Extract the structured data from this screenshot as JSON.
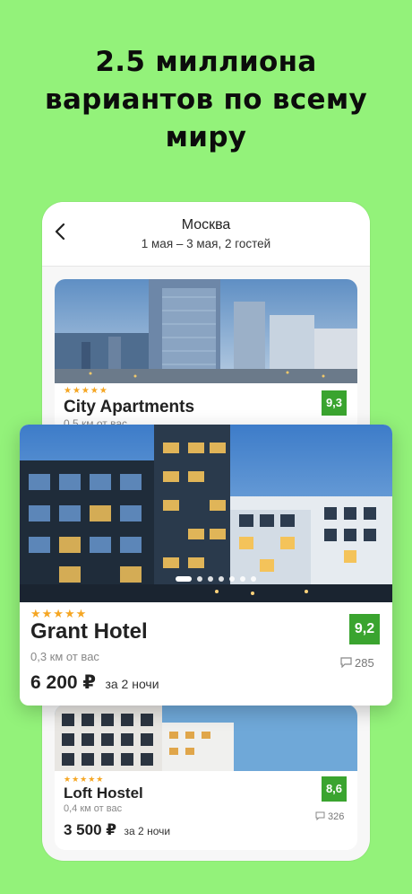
{
  "headline": {
    "line1": "2.5 миллиона",
    "line2": "вариантов по всему",
    "line3": "миру"
  },
  "nav": {
    "title": "Москва",
    "subtitle": "1 мая – 3 мая, 2 гостей"
  },
  "hotels": [
    {
      "name": "City Apartments",
      "stars": "★★★★★",
      "distance": "0,5 км от вас",
      "rating": "9,3"
    },
    {
      "name": "Grant Hotel",
      "stars": "★★★★★",
      "distance": "0,3 км от вас",
      "price": "6 200 ₽",
      "per": "за 2 ночи",
      "rating": "9,2",
      "reviews": "285"
    },
    {
      "name": "Loft Hostel",
      "stars": "★★★★★",
      "distance": "0,4 км от вас",
      "price": "3 500 ₽",
      "per": "за 2 ночи",
      "rating": "8,6",
      "reviews": "326"
    }
  ],
  "colors": {
    "background": "#93f27a",
    "rating_badge": "#3aa42f",
    "stars": "#f5a623"
  }
}
